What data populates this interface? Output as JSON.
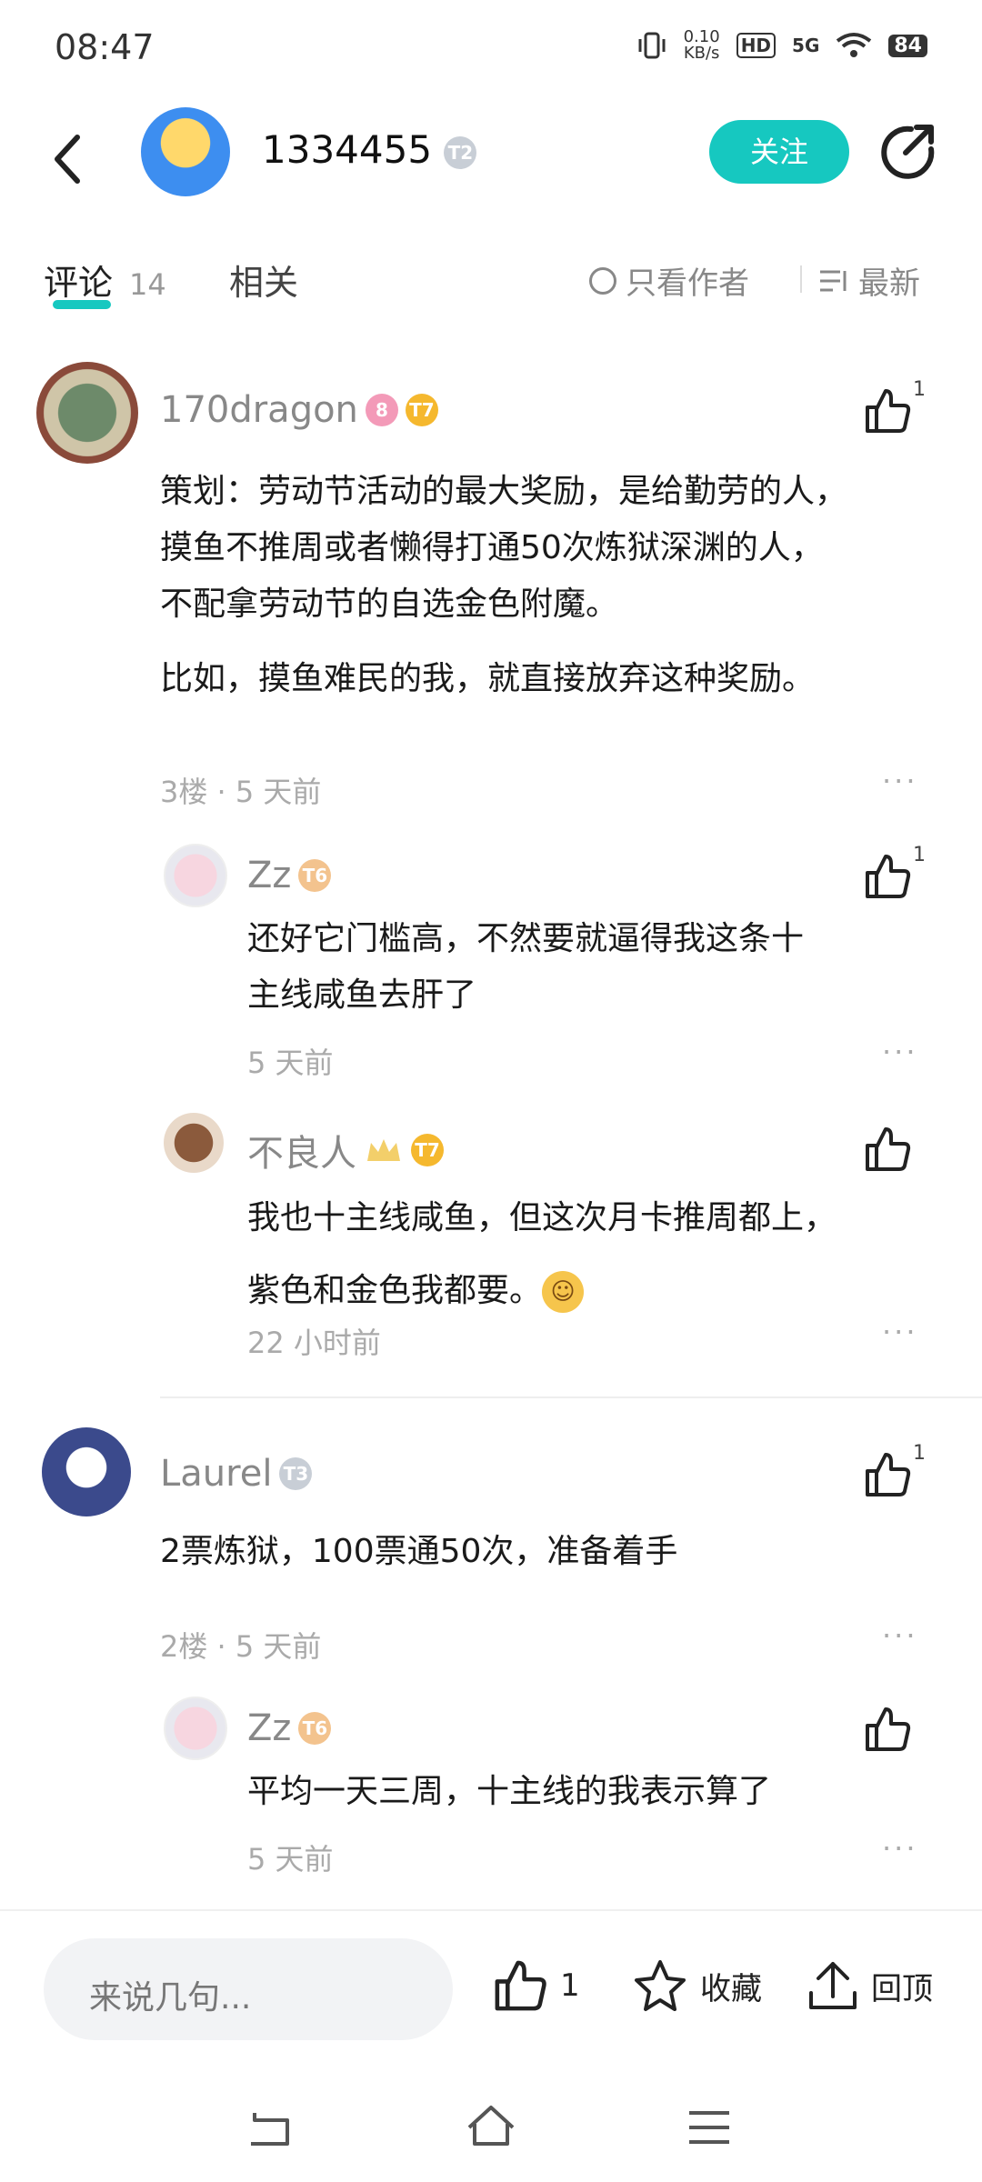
{
  "status": {
    "time": "08:47",
    "speed_top": "0.10",
    "speed_bottom": "KB/s",
    "hd": "HD",
    "net": "5G",
    "battery": "84"
  },
  "header": {
    "username": "1334455",
    "badge": "T2",
    "follow": "关注"
  },
  "tabs": {
    "comments_label": "评论",
    "comments_count": "14",
    "related": "相关",
    "only_author": "只看作者",
    "sort": "最新"
  },
  "comments": [
    {
      "name": "170dragon",
      "badge_num": "8",
      "badge_t": "T7",
      "likes": "1",
      "para1": [
        "策划：劳动节活动的最大奖励，是给勤劳的人，",
        "摸鱼不推周或者懒得打通50次炼狱深渊的人，",
        "不配拿劳动节的自选金色附魔。"
      ],
      "para2": "比如，摸鱼难民的我，就直接放弃这种奖励。",
      "meta": "3楼 · 5 天前"
    },
    {
      "name": "Laurel",
      "badge_t": "T3",
      "likes": "1",
      "text": "2票炼狱，100票通50次，准备着手",
      "meta": "2楼 · 5 天前"
    }
  ],
  "replies": [
    {
      "name": "Zz",
      "badge_t": "T6",
      "likes": "1",
      "lines": [
        "还好它门槛高，不然要就逼得我这条十",
        "主线咸鱼去肝了"
      ],
      "meta": "5 天前"
    },
    {
      "name": "不良人",
      "badge_t": "T7",
      "likes": "",
      "lines": [
        "我也十主线咸鱼，但这次月卡推周都上，",
        "紫色和金色我都要。"
      ],
      "meta": "22 小时前"
    },
    {
      "name": "Zz",
      "badge_t": "T6",
      "likes": "",
      "lines": [
        "平均一天三周，十主线的我表示算了"
      ],
      "meta": "5 天前"
    }
  ],
  "bottom": {
    "placeholder": "来说几句...",
    "like_count": "1",
    "collect": "收藏",
    "top": "回顶"
  },
  "more": "···"
}
